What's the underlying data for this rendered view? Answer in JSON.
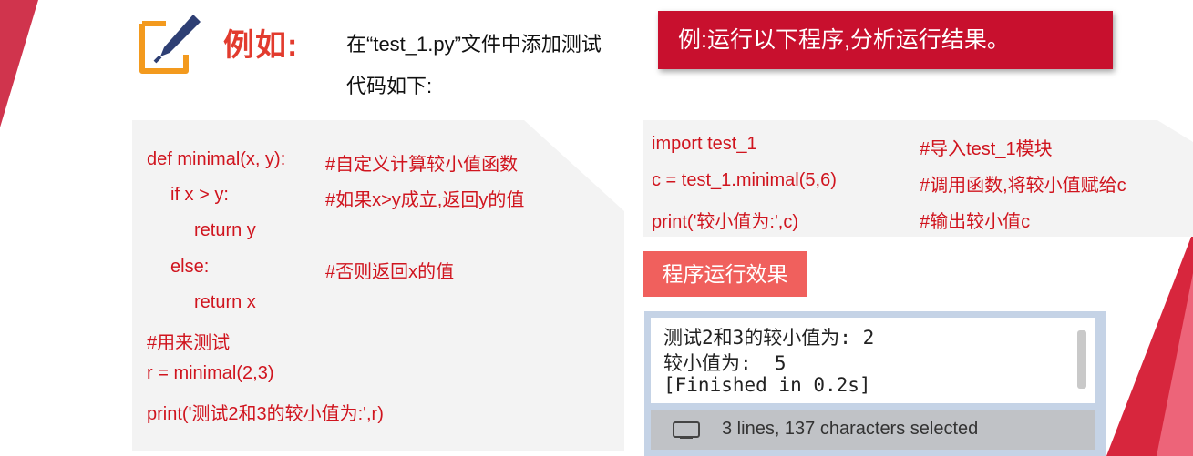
{
  "header": {
    "title": "例如:",
    "intro": "在“test_1.py”文件中添加测试代码如下:",
    "banner": "例:运行以下程序,分析运行结果。"
  },
  "code_left": [
    {
      "code": "def minimal(x, y):",
      "comment": "#自定义计算较小值函数"
    },
    {
      "code": "if x > y:",
      "comment": "#如果x>y成立,返回y的值"
    },
    {
      "code": "return y",
      "comment": ""
    },
    {
      "code": "else:",
      "comment": "#否则返回x的值"
    },
    {
      "code": "return x",
      "comment": ""
    },
    {
      "code": "#用来测试",
      "comment": ""
    },
    {
      "code": "r = minimal(2,3)",
      "comment": ""
    },
    {
      "code": "print('测试2和3的较小值为:',r)",
      "comment": ""
    }
  ],
  "code_right": [
    {
      "code": "import test_1",
      "comment": "#导入test_1模块"
    },
    {
      "code": "c = test_1.minimal(5,6)",
      "comment": "#调用函数,将较小值赋给c"
    },
    {
      "code": "print('较小值为:',c)",
      "comment": "#输出较小值c"
    }
  ],
  "effect_label": "程序运行效果",
  "console": {
    "lines": [
      "测试2和3的较小值为: 2",
      "较小值为:  5",
      "[Finished in 0.2s]"
    ],
    "status": "3 lines, 137 characters selected"
  },
  "colors": {
    "accent": "#c8102e",
    "code": "#d0141e",
    "effect": "#f0605d"
  },
  "icons": {
    "header": "pen-paper-icon",
    "status": "monitor-icon"
  }
}
